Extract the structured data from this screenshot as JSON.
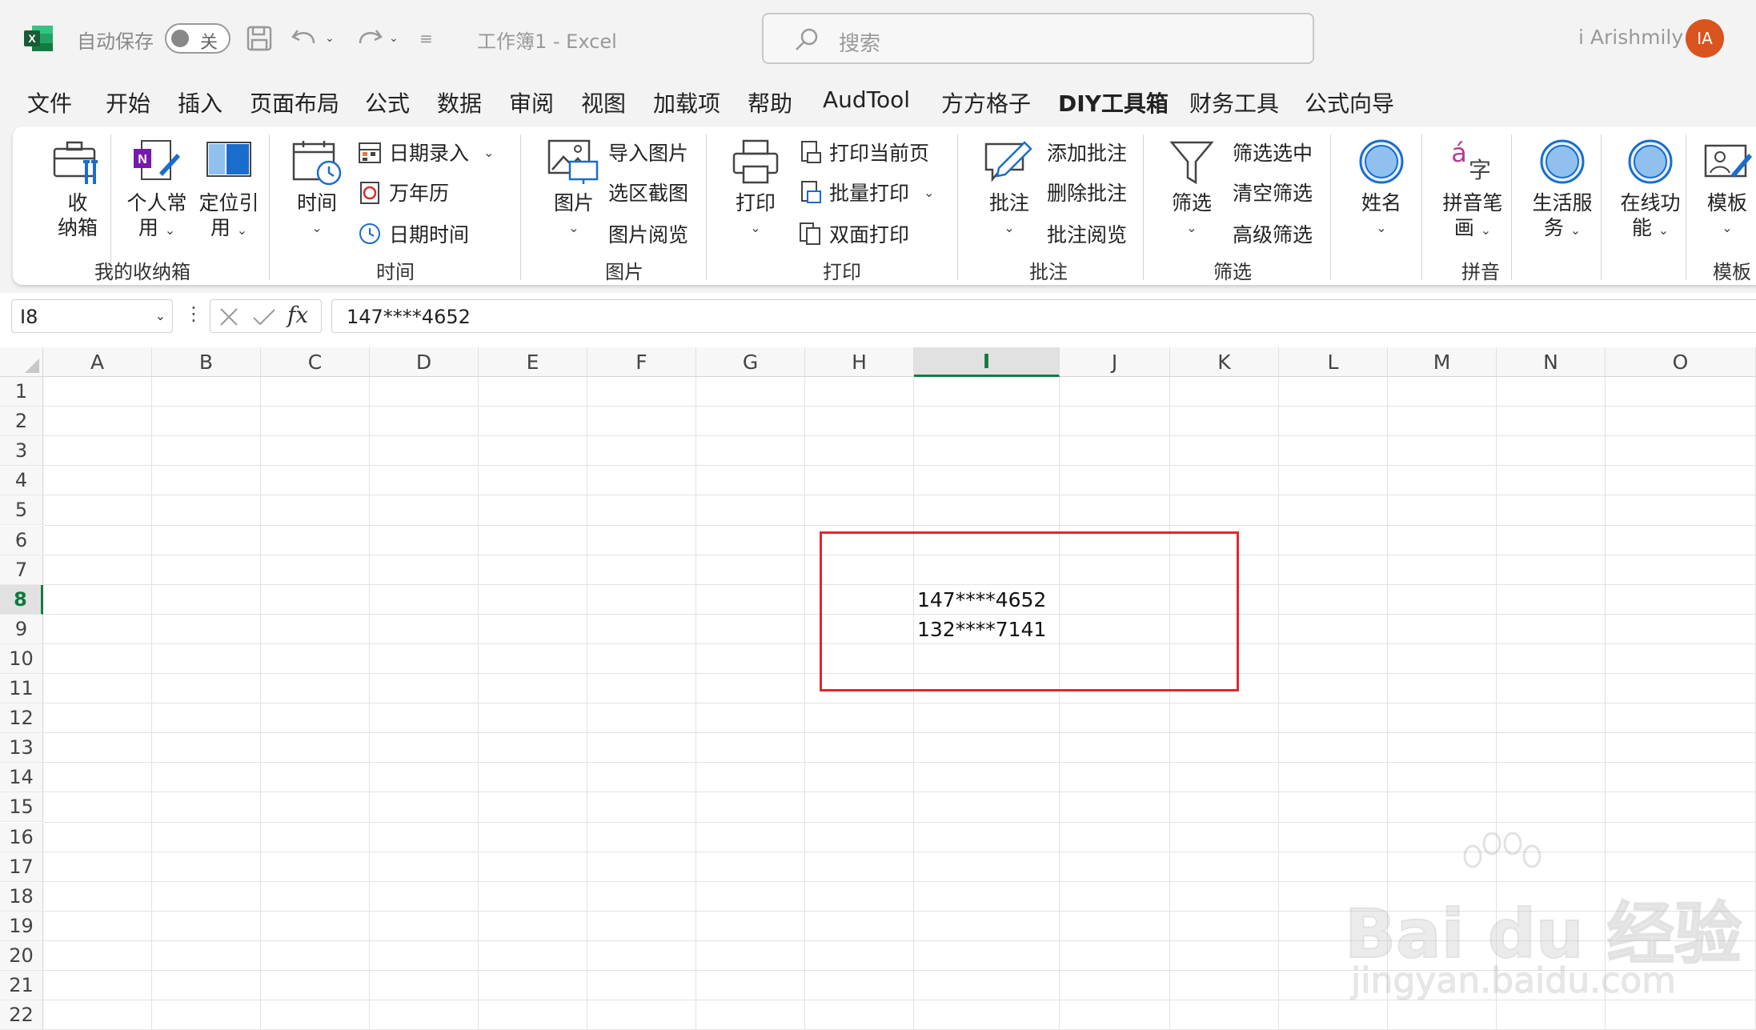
{
  "titlebar": {
    "app_icon": "excel-logo-icon",
    "autosave_label": "自动保存",
    "autosave_state": "关",
    "doc_title": "工作簿1  -  Excel",
    "search_placeholder": "搜索",
    "user_name": "i Arishmily",
    "avatar_initials": "IA",
    "avatar_color": "#d9541e"
  },
  "menu": {
    "tabs": [
      "文件",
      "开始",
      "插入",
      "页面布局",
      "公式",
      "数据",
      "审阅",
      "视图",
      "加载项",
      "帮助",
      "AudTool",
      "方方格子",
      "DIY工具箱",
      "财务工具",
      "公式向导"
    ],
    "active_tab": "DIY工具箱",
    "accent_color": "#107c41"
  },
  "ribbon": {
    "groups": {
      "storage": "我的收纳箱",
      "time": "时间",
      "picture": "图片",
      "print": "打印",
      "comment": "批注",
      "filter": "筛选",
      "pinyin": "拼音",
      "template": "模板"
    },
    "buttons": {
      "storage_big": [
        "收",
        "纳箱"
      ],
      "personal": [
        "个人常",
        "用"
      ],
      "locate_ref": [
        "定位引",
        "用"
      ],
      "time_big": "时间",
      "date_entry": "日期录入",
      "calendar": "万年历",
      "datetime": "日期时间",
      "picture_big": "图片",
      "import_pic": "导入图片",
      "screenshot": "选区截图",
      "pic_browse": "图片阅览",
      "print_big": "打印",
      "print_current": "打印当前页",
      "batch_print": "批量打印",
      "duplex_print": "双面打印",
      "comment_big": "批注",
      "add_comment": "添加批注",
      "delete_comment": "删除批注",
      "browse_comment": "批注阅览",
      "filter_big": "筛选",
      "filter_selected": "筛选选中",
      "clear_filter": "清空筛选",
      "advanced_filter": "高级筛选",
      "name": "姓名",
      "pinyin_stroke": [
        "拼音笔",
        "画"
      ],
      "life_service": [
        "生活服",
        "务"
      ],
      "online": [
        "在线功",
        "能"
      ],
      "template_big": "模板"
    }
  },
  "formula_bar": {
    "name_box": "I8",
    "fx_label": "fx",
    "value": "147****4652"
  },
  "sheet": {
    "columns": [
      "A",
      "B",
      "C",
      "D",
      "E",
      "F",
      "G",
      "H",
      "I",
      "J",
      "K",
      "L",
      "M",
      "N",
      "O"
    ],
    "rows": [
      "1",
      "2",
      "3",
      "4",
      "5",
      "6",
      "7",
      "8",
      "9",
      "10",
      "11",
      "12",
      "13",
      "14",
      "15",
      "16",
      "17",
      "18",
      "19",
      "20",
      "21",
      "22"
    ],
    "selected_column": "I",
    "selected_row": "8",
    "cells": {
      "I8": "147****4652",
      "I9": "132****7141"
    },
    "highlight_color": "#e0282e"
  },
  "watermark": {
    "main": "Bai du 经验",
    "sub": "jingyan.baidu.com"
  }
}
